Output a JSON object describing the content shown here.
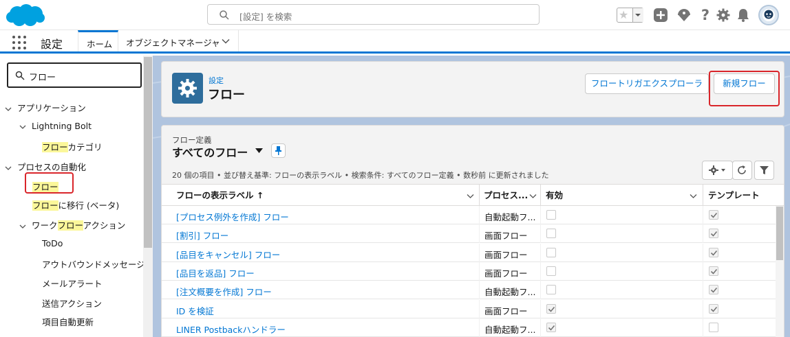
{
  "header": {
    "search_placeholder": "[設定] を検索"
  },
  "nav": {
    "app_name": "設定",
    "tabs": [
      {
        "label": "ホーム"
      },
      {
        "label": "オブジェクトマネージャ"
      }
    ]
  },
  "sidebar": {
    "quick_find_value": "フロー",
    "items": [
      {
        "label": "アプリケーション"
      },
      {
        "label": "Lightning Bolt"
      },
      {
        "label_hl": "フロー",
        "label_rest": "カテゴリ"
      },
      {
        "label": "プロセスの自動化"
      },
      {
        "label_hl": "フロー"
      },
      {
        "label_hl": "フロー",
        "label_rest": "に移行 (ベータ)"
      },
      {
        "label_pre": "ワーク",
        "label_hl": "フロー",
        "label_rest": "アクション"
      },
      {
        "label": "ToDo"
      },
      {
        "label": "アウトバウンドメッセージ"
      },
      {
        "label": "メールアラート"
      },
      {
        "label": "送信アクション"
      },
      {
        "label": "項目自動更新"
      }
    ]
  },
  "page_header": {
    "breadcrumb": "設定",
    "title": "フロー",
    "trigger_explorer_button": "フロートリガエクスプローラ",
    "new_flow_button": "新規フロー"
  },
  "list_view": {
    "object_label": "フロー定義",
    "view_name": "すべてのフロー",
    "meta": "20 個の項目 • 並び替え基準: フローの表示ラベル • 検索条件: すべてのフロー定義 • 数秒前 に更新されました",
    "columns": [
      {
        "label": "フローの表示ラベル ↑"
      },
      {
        "label": "プロセス..."
      },
      {
        "label": "有効"
      },
      {
        "label": "テンプレート"
      }
    ],
    "rows": [
      {
        "label": "[プロセス例外を作成] フロー",
        "process": "自動起動フ...",
        "active": false,
        "template": true
      },
      {
        "label": "[割引] フロー",
        "process": "画面フロー",
        "active": false,
        "template": true
      },
      {
        "label": "[品目をキャンセル] フロー",
        "process": "画面フロー",
        "active": false,
        "template": true
      },
      {
        "label": "[品目を返品] フロー",
        "process": "画面フロー",
        "active": false,
        "template": true
      },
      {
        "label": "[注文概要を作成] フロー",
        "process": "自動起動フ...",
        "active": false,
        "template": true
      },
      {
        "label": "ID を検証",
        "process": "画面フロー",
        "active": true,
        "template": true
      },
      {
        "label": "LINER Postbackハンドラー",
        "process": "自動起動フ...",
        "active": true,
        "template": false
      }
    ]
  },
  "colors": {
    "brand_blue": "#0176d3",
    "salesforce_cloud": "#00a1e0",
    "highlight": "#fbf79a",
    "annotation_red": "#d9252a"
  }
}
